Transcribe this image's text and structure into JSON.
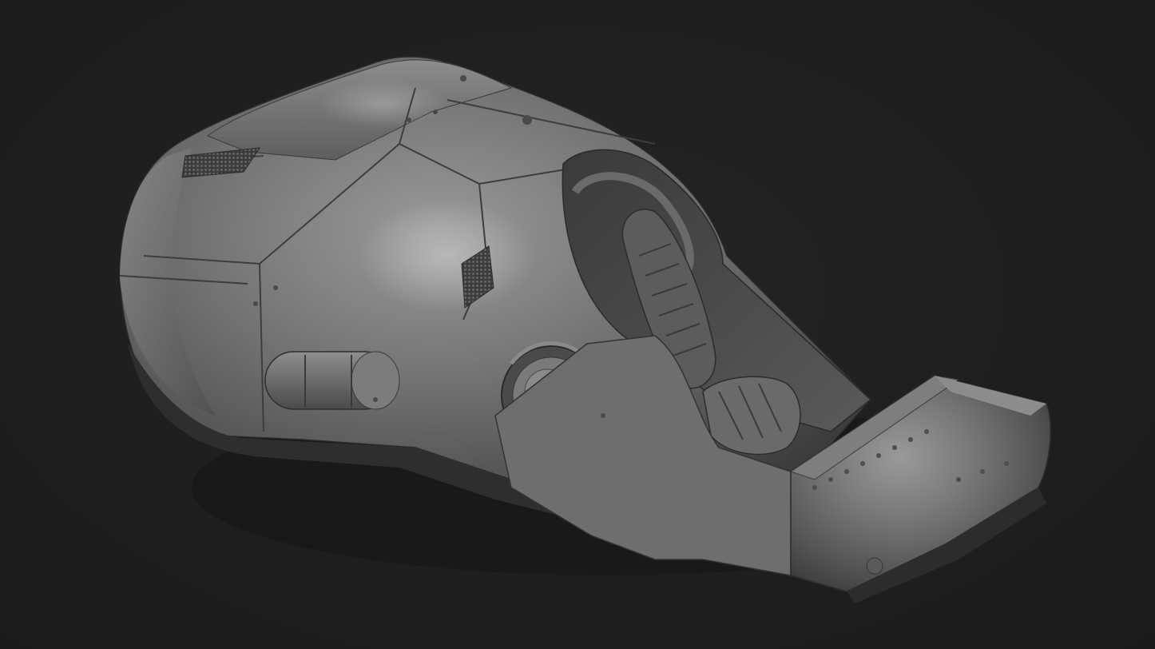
{
  "scene": {
    "subject": "sculpted-vehicle-render",
    "background_color": "#1f1f1f",
    "material_color": "#6e6e6e"
  }
}
